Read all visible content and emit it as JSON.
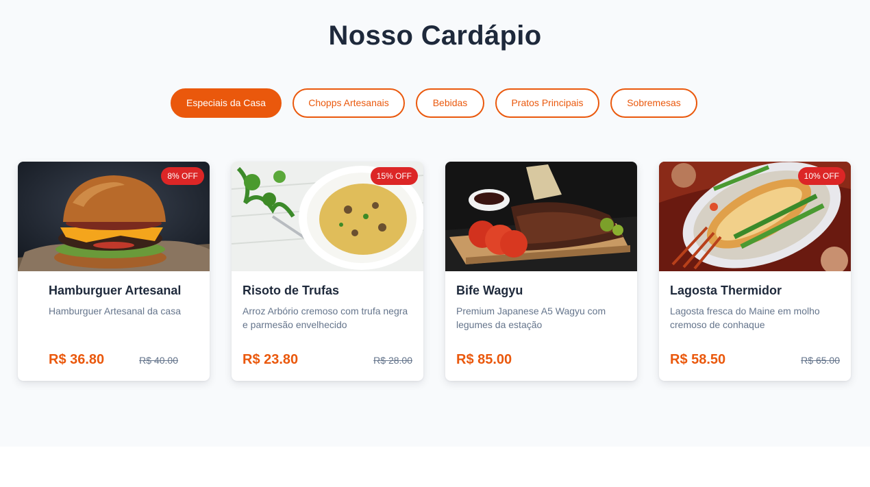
{
  "menu": {
    "title": "Nosso Cardápio",
    "tabs": [
      {
        "label": "Especiais da Casa",
        "active": true
      },
      {
        "label": "Chopps Artesanais",
        "active": false
      },
      {
        "label": "Bebidas",
        "active": false
      },
      {
        "label": "Pratos Principais",
        "active": false
      },
      {
        "label": "Sobremesas",
        "active": false
      }
    ],
    "items": [
      {
        "name": "Hamburguer Artesanal",
        "description": "Hamburguer Artesanal da casa",
        "price": "R$ 36.80",
        "old_price": "R$ 40.00",
        "discount": "8% OFF",
        "image_icon": "burger-photo-icon"
      },
      {
        "name": "Risoto de Trufas",
        "description": "Arroz Arbório cremoso com trufa negra e parmesão envelhecido",
        "price": "R$ 23.80",
        "old_price": "R$ 28.00",
        "discount": "15% OFF",
        "image_icon": "risotto-photo-icon"
      },
      {
        "name": "Bife Wagyu",
        "description": "Premium Japanese A5 Wagyu com legumes da estação",
        "price": "R$ 85.00",
        "image_icon": "ribs-photo-icon"
      },
      {
        "name": "Lagosta Thermidor",
        "description": "Lagosta fresca do Maine em molho cremoso de conhaque",
        "price": "R$ 58.50",
        "old_price": "R$ 65.00",
        "discount": "10% OFF",
        "image_icon": "lobster-photo-icon"
      }
    ]
  },
  "colors": {
    "accent": "#ea580c",
    "badge": "#dc2626",
    "heading": "#1e293b",
    "muted": "#64748b",
    "background": "#f8fafc"
  }
}
